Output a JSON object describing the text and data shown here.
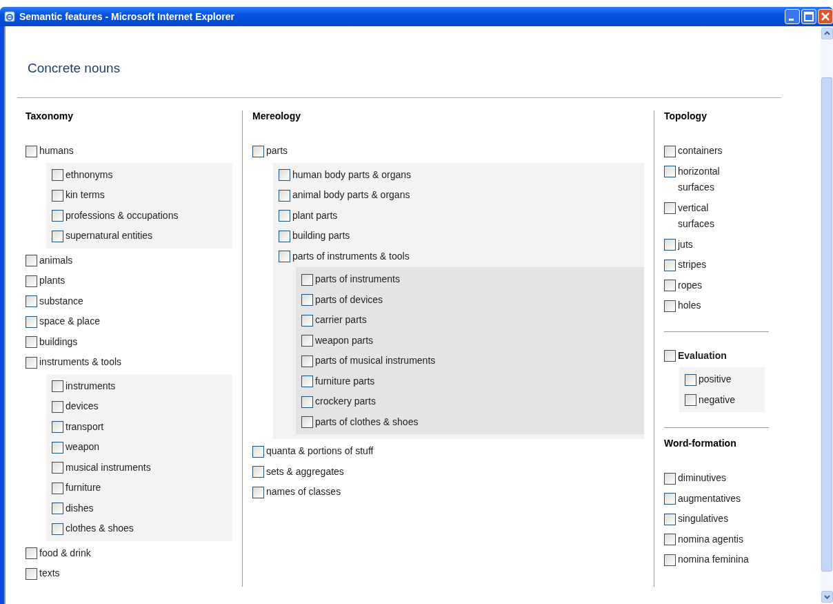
{
  "window": {
    "title": "Semantic features - Microsoft Internet Explorer"
  },
  "page": {
    "title": "Concrete nouns"
  },
  "columns": [
    {
      "sections": [
        {
          "kind": "plain",
          "heading": "Taxonomy",
          "items": [
            {
              "label": "humans",
              "checked": false,
              "children": [
                {
                  "label": "ethnonyms",
                  "checked": false
                },
                {
                  "label": "kin terms",
                  "checked": false
                },
                {
                  "label": "professions & occupations",
                  "checked": false
                },
                {
                  "label": "supernatural entities",
                  "checked": false
                }
              ]
            },
            {
              "label": "animals",
              "checked": false
            },
            {
              "label": "plants",
              "checked": false
            },
            {
              "label": "substance",
              "checked": false
            },
            {
              "label": "space & place",
              "checked": false
            },
            {
              "label": "buildings",
              "checked": false
            },
            {
              "label": "instruments & tools",
              "checked": false,
              "children": [
                {
                  "label": "instruments",
                  "checked": false
                },
                {
                  "label": "devices",
                  "checked": false
                },
                {
                  "label": "transport",
                  "checked": false
                },
                {
                  "label": "weapon",
                  "checked": false
                },
                {
                  "label": "musical instruments",
                  "checked": false
                },
                {
                  "label": "furniture",
                  "checked": false
                },
                {
                  "label": "dishes",
                  "checked": false
                },
                {
                  "label": "clothes & shoes",
                  "checked": false
                }
              ]
            },
            {
              "label": "food & drink",
              "checked": false
            },
            {
              "label": "texts",
              "checked": false
            }
          ]
        }
      ]
    },
    {
      "sections": [
        {
          "kind": "plain",
          "heading": "Mereology",
          "items": [
            {
              "label": "parts",
              "checked": false,
              "children": [
                {
                  "label": "human body parts & organs",
                  "checked": false
                },
                {
                  "label": "animal body parts & organs",
                  "checked": false
                },
                {
                  "label": "plant parts",
                  "checked": false
                },
                {
                  "label": "building parts",
                  "checked": false
                },
                {
                  "label": "parts of instruments & tools",
                  "checked": false,
                  "children": [
                    {
                      "label": "parts of instruments",
                      "checked": false
                    },
                    {
                      "label": "parts of devices",
                      "checked": false
                    },
                    {
                      "label": "carrier parts",
                      "checked": false
                    },
                    {
                      "label": "weapon parts",
                      "checked": false
                    },
                    {
                      "label": "parts of musical instruments",
                      "checked": false
                    },
                    {
                      "label": "furniture parts",
                      "checked": false
                    },
                    {
                      "label": "crockery parts",
                      "checked": false
                    },
                    {
                      "label": "parts of clothes & shoes",
                      "checked": false
                    }
                  ]
                }
              ]
            },
            {
              "label": "quanta & portions of stuff",
              "checked": false
            },
            {
              "label": "sets & aggregates",
              "checked": false
            },
            {
              "label": "names of classes",
              "checked": false
            }
          ]
        }
      ]
    },
    {
      "sections": [
        {
          "kind": "plain",
          "heading": "Topology",
          "items": [
            {
              "label": "containers",
              "checked": false
            },
            {
              "label": "horizontal surfaces",
              "checked": false
            },
            {
              "label": "vertical surfaces",
              "checked": false
            },
            {
              "label": "juts",
              "checked": false
            },
            {
              "label": "stripes",
              "checked": false
            },
            {
              "label": "ropes",
              "checked": false
            },
            {
              "label": "holes",
              "checked": false
            }
          ]
        },
        {
          "kind": "checkable",
          "heading": "Evaluation",
          "checked": false,
          "items": [
            {
              "label": "positive",
              "checked": false
            },
            {
              "label": "negative",
              "checked": false
            }
          ]
        },
        {
          "kind": "plain",
          "heading": "Word-formation",
          "items": [
            {
              "label": "diminutives",
              "checked": false
            },
            {
              "label": "augmentatives",
              "checked": false
            },
            {
              "label": "singulatives",
              "checked": false
            },
            {
              "label": "nomina agentis",
              "checked": false
            },
            {
              "label": "nomina feminina",
              "checked": false
            }
          ]
        }
      ]
    }
  ]
}
